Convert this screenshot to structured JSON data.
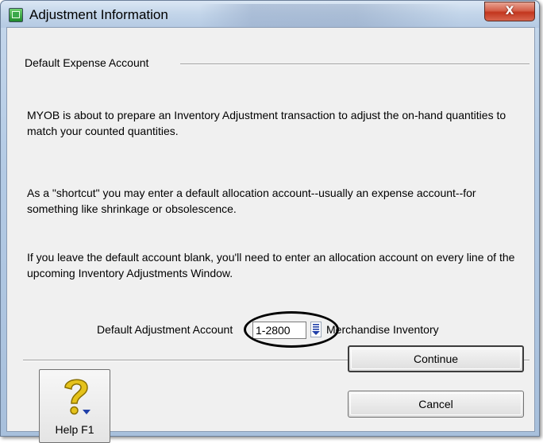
{
  "window": {
    "title": "Adjustment Information",
    "close_label": "X"
  },
  "group": {
    "label": "Default Expense Account"
  },
  "paragraphs": {
    "p1": "MYOB is about to prepare an Inventory Adjustment transaction to adjust the on-hand quantities to match your counted quantities.",
    "p2": "As a \"shortcut\" you may enter a default allocation account--usually an expense account--for something like shrinkage or obsolescence.",
    "p3": "If you leave the default account blank, you'll need to enter an allocation account on every line of the upcoming Inventory Adjustments Window."
  },
  "account": {
    "label": "Default Adjustment Account",
    "value": "1-2800",
    "name": "Merchandise Inventory"
  },
  "buttons": {
    "help": "Help F1",
    "continue": "Continue",
    "cancel": "Cancel"
  },
  "icons": {
    "app": "myob-app-icon",
    "lookup": "list-lookup-icon",
    "help": "question-mark-icon"
  },
  "colors": {
    "close_button": "#c2361e",
    "lookup_arrow": "#1f3fa8",
    "help_question": "#e5c21a"
  }
}
